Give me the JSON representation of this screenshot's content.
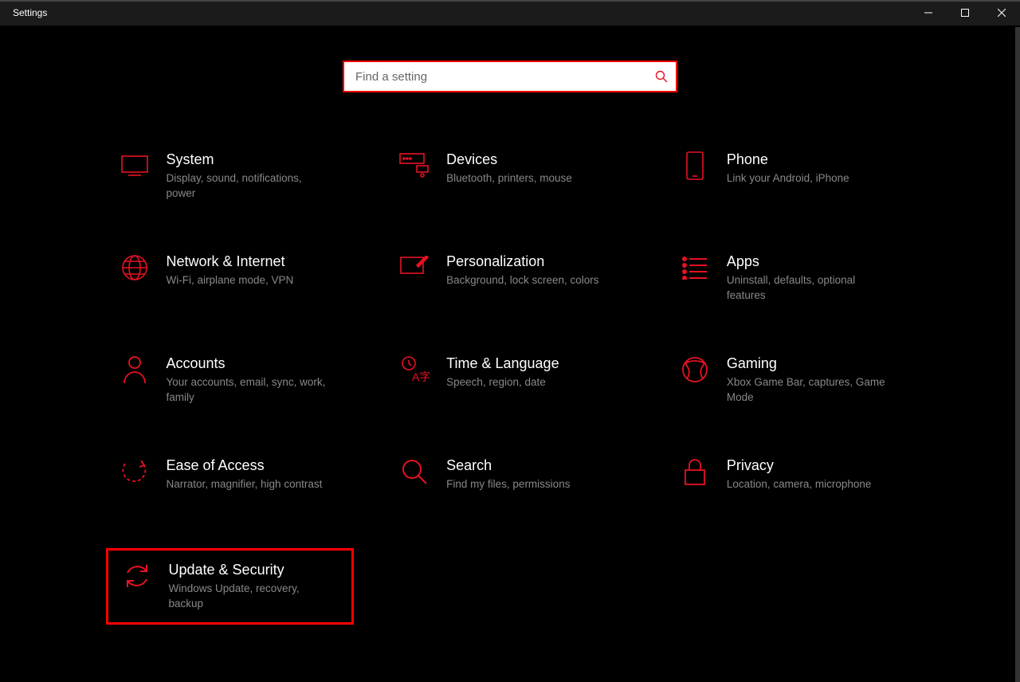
{
  "window": {
    "title": "Settings"
  },
  "search": {
    "placeholder": "Find a setting"
  },
  "tiles": [
    {
      "title": "System",
      "desc": "Display, sound, notifications, power"
    },
    {
      "title": "Devices",
      "desc": "Bluetooth, printers, mouse"
    },
    {
      "title": "Phone",
      "desc": "Link your Android, iPhone"
    },
    {
      "title": "Network & Internet",
      "desc": "Wi-Fi, airplane mode, VPN"
    },
    {
      "title": "Personalization",
      "desc": "Background, lock screen, colors"
    },
    {
      "title": "Apps",
      "desc": "Uninstall, defaults, optional features"
    },
    {
      "title": "Accounts",
      "desc": "Your accounts, email, sync, work, family"
    },
    {
      "title": "Time & Language",
      "desc": "Speech, region, date"
    },
    {
      "title": "Gaming",
      "desc": "Xbox Game Bar, captures, Game Mode"
    },
    {
      "title": "Ease of Access",
      "desc": "Narrator, magnifier, high contrast"
    },
    {
      "title": "Search",
      "desc": "Find my files, permissions"
    },
    {
      "title": "Privacy",
      "desc": "Location, camera, microphone"
    },
    {
      "title": "Update & Security",
      "desc": "Windows Update, recovery, backup"
    }
  ],
  "colors": {
    "accent": "#e81123"
  }
}
